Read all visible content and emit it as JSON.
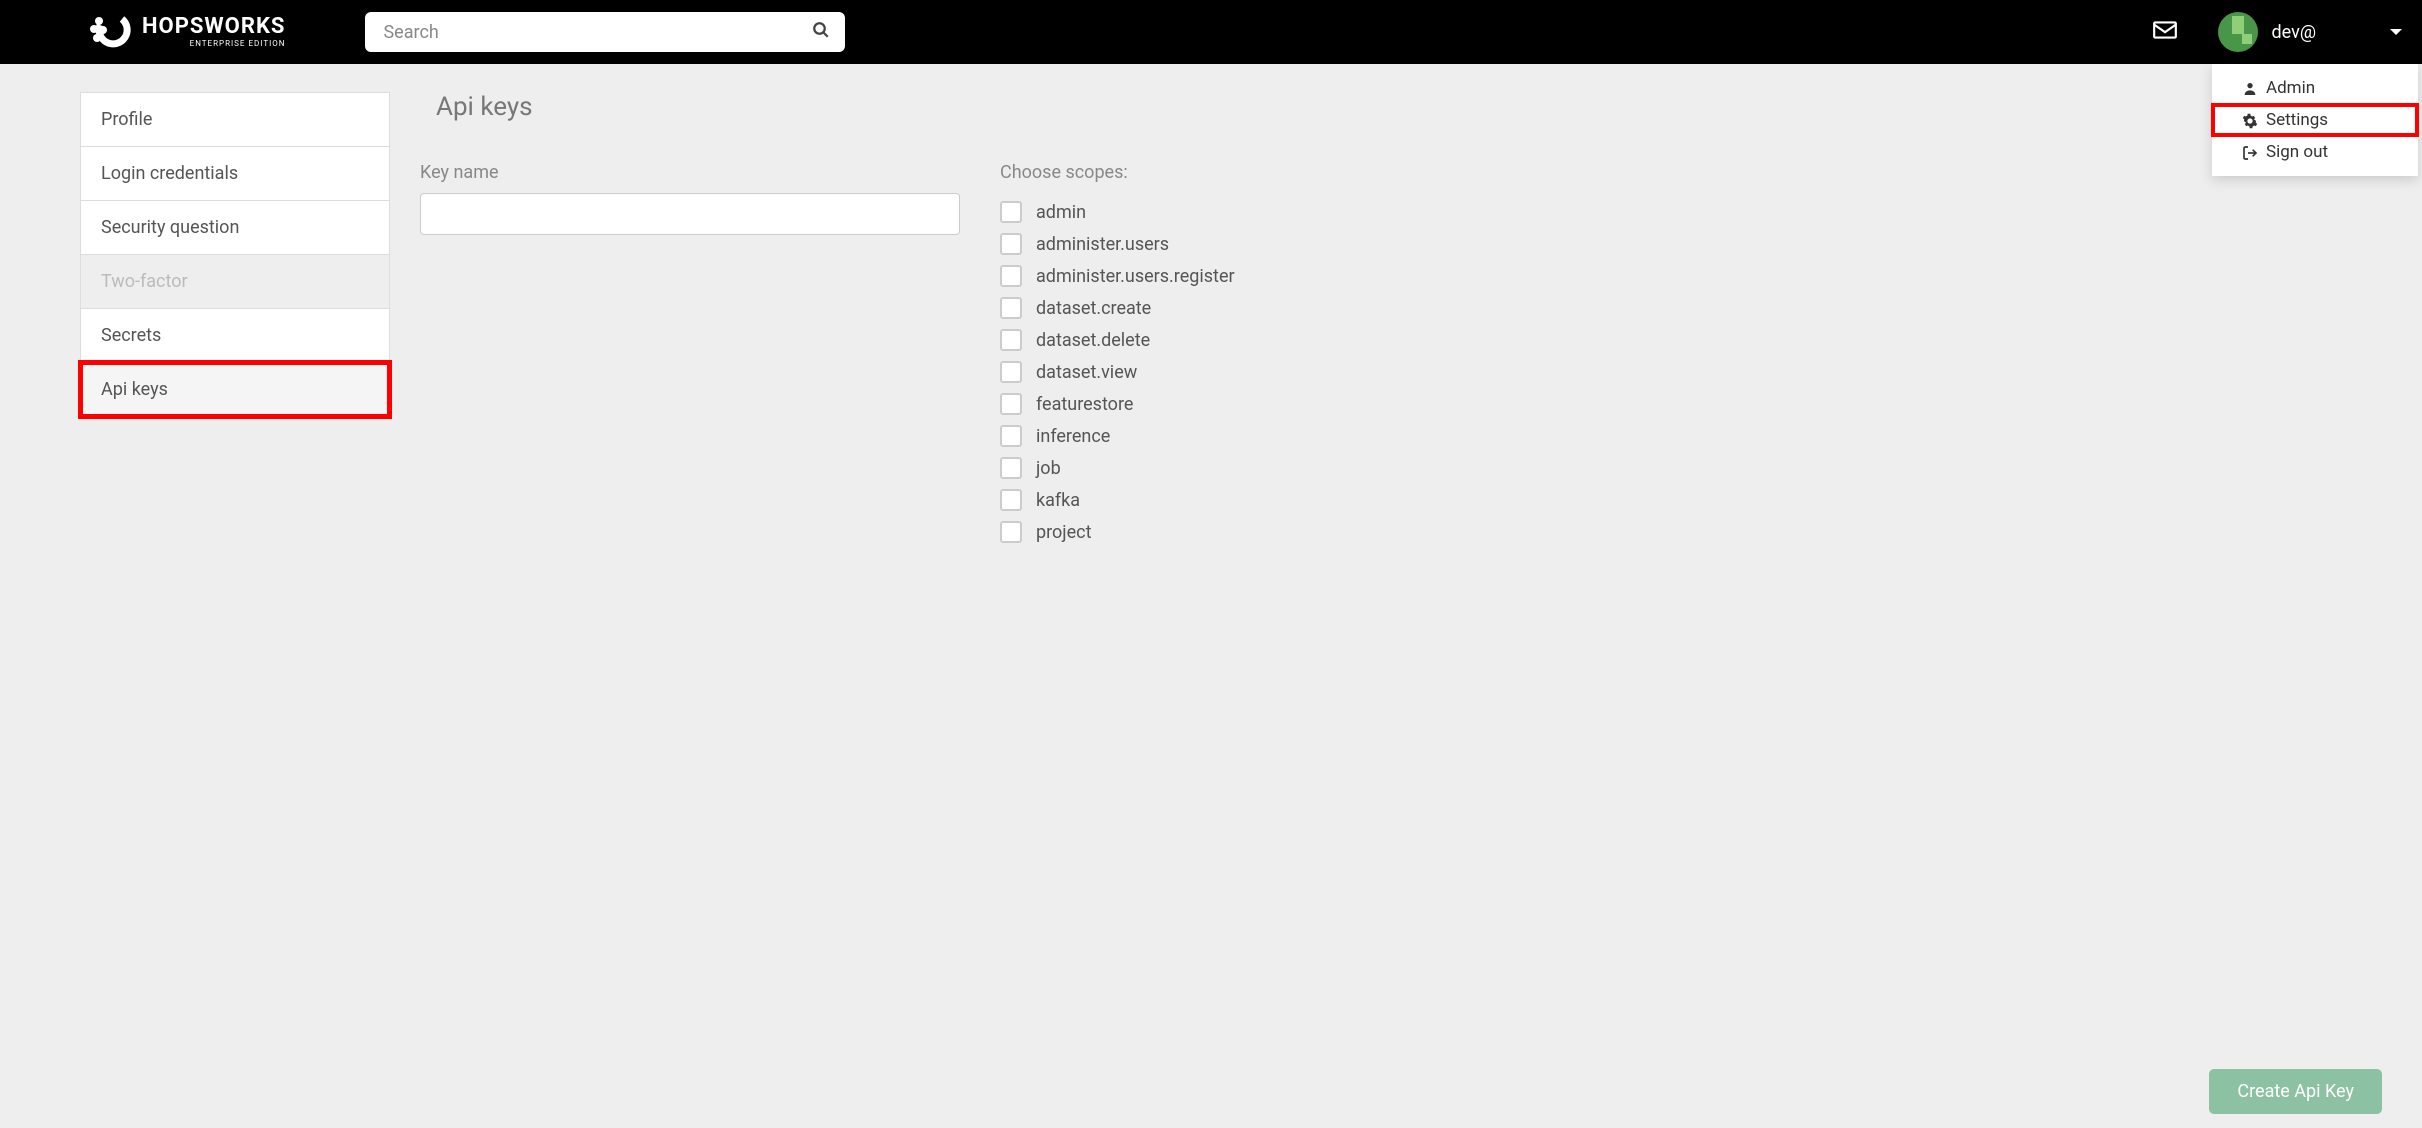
{
  "header": {
    "logo_title": "HOPSWORKS",
    "logo_subtitle": "ENTERPRISE EDITION",
    "search_placeholder": "Search",
    "username": "dev@"
  },
  "dropdown": {
    "items": [
      {
        "label": "Admin"
      },
      {
        "label": "Settings",
        "highlighted": true
      },
      {
        "label": "Sign out"
      }
    ]
  },
  "sidebar": {
    "items": [
      {
        "label": "Profile"
      },
      {
        "label": "Login credentials"
      },
      {
        "label": "Security question"
      },
      {
        "label": "Two-factor",
        "disabled": true
      },
      {
        "label": "Secrets"
      },
      {
        "label": "Api keys",
        "active": true,
        "highlighted": true
      }
    ]
  },
  "page": {
    "title": "Api keys",
    "key_name_label": "Key name",
    "key_name_value": "",
    "scopes_label": "Choose scopes:",
    "scopes": [
      {
        "label": "admin"
      },
      {
        "label": "administer.users"
      },
      {
        "label": "administer.users.register"
      },
      {
        "label": "dataset.create"
      },
      {
        "label": "dataset.delete"
      },
      {
        "label": "dataset.view"
      },
      {
        "label": "featurestore"
      },
      {
        "label": "inference"
      },
      {
        "label": "job"
      },
      {
        "label": "kafka"
      },
      {
        "label": "project"
      }
    ],
    "create_button": "Create Api Key"
  }
}
